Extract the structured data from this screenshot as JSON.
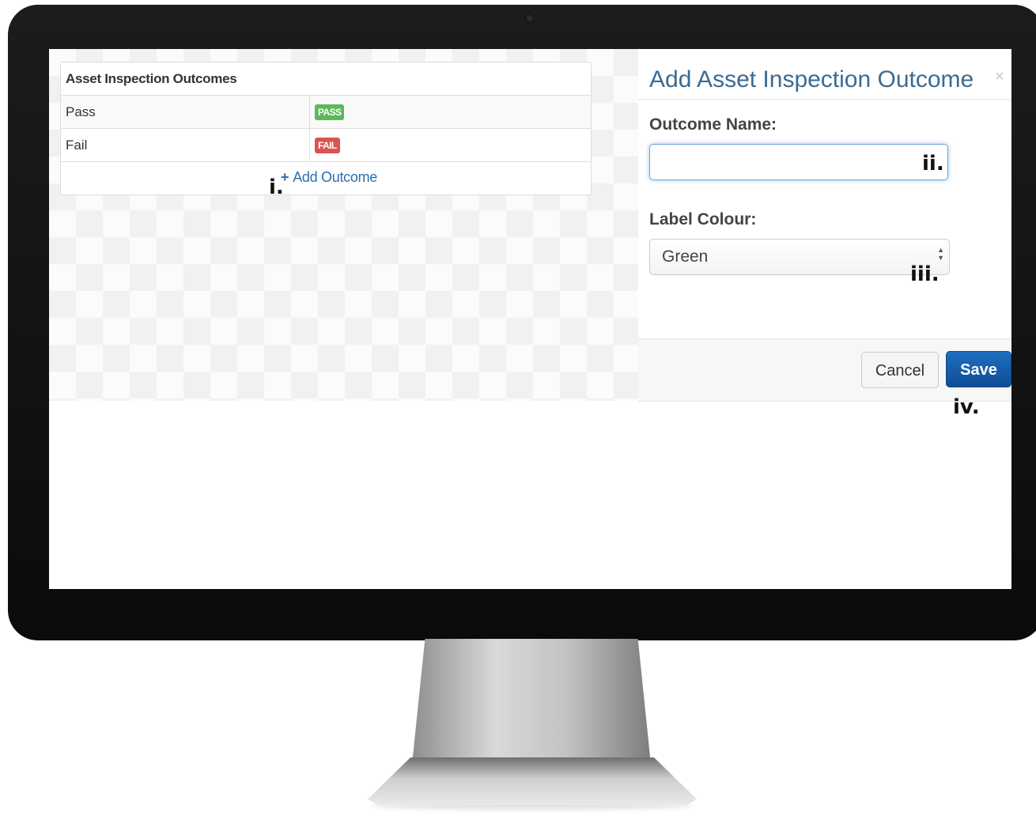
{
  "table": {
    "header": "Asset Inspection Outcomes",
    "rows": [
      {
        "name": "Pass",
        "badge": "PASS",
        "badge_color": "#5cb85c"
      },
      {
        "name": "Fail",
        "badge": "FAIL",
        "badge_color": "#d9534f"
      }
    ],
    "add_icon": "+",
    "add_label": "Add Outcome"
  },
  "modal": {
    "title": "Add Asset Inspection Outcome",
    "close_icon": "×",
    "outcome_label": "Outcome Name:",
    "outcome_value": "",
    "colour_label": "Label Colour:",
    "colour_selected": "Green",
    "cancel_label": "Cancel",
    "save_label": "Save"
  },
  "annotations": {
    "i": "i.",
    "ii": "ii.",
    "iii": "iii.",
    "iv": "iv."
  },
  "colors": {
    "link": "#2a6fb0",
    "modal_title": "#3a6b93",
    "save_button": "#1560b0"
  }
}
